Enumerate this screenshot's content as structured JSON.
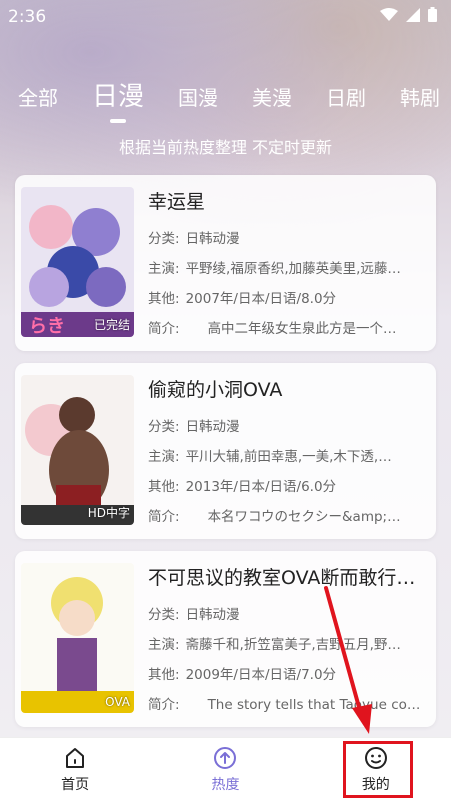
{
  "status_bar": {
    "time": "2:36"
  },
  "tabs": [
    {
      "label": "全部",
      "active": false
    },
    {
      "label": "日漫",
      "active": true
    },
    {
      "label": "国漫",
      "active": false
    },
    {
      "label": "美漫",
      "active": false
    },
    {
      "label": "日剧",
      "active": false
    },
    {
      "label": "韩剧",
      "active": false
    }
  ],
  "subtitle": "根据当前热度整理 不定时更新",
  "cards": [
    {
      "title": "幸运星",
      "category_key": "分类:",
      "category": "日韩动漫",
      "cast_key": "主演:",
      "cast": "平野绫,福原香织,加藤英美里,远藤…",
      "other_key": "其他:",
      "other": "2007年/日本/日语/8.0分",
      "intro_key": "简介:",
      "intro": "高中二年级女生泉此方是一个…",
      "badge": "已完结"
    },
    {
      "title": "偷窥的小洞OVA",
      "category_key": "分类:",
      "category": "日韩动漫",
      "cast_key": "主演:",
      "cast": "平川大辅,前田幸惠,一美,木下透,…",
      "other_key": "其他:",
      "other": "2013年/日本/日语/6.0分",
      "intro_key": "简介:",
      "intro": "本名ワコウのセクシー&amp;…",
      "badge": "HD中字"
    },
    {
      "title": "不可思议的教室OVA断而敢行…",
      "category_key": "分类:",
      "category": "日韩动漫",
      "cast_key": "主演:",
      "cast": "斋藤千和,折笠富美子,吉野五月,野…",
      "other_key": "其他:",
      "other": "2009年/日本/日语/7.0分",
      "intro_key": "简介:",
      "intro": "The story tells that Taoyue co…",
      "badge": "OVA"
    }
  ],
  "bottom_nav": [
    {
      "label": "首页",
      "icon": "home-icon",
      "active": false
    },
    {
      "label": "热度",
      "icon": "hot-upload-icon",
      "active": true
    },
    {
      "label": "我的",
      "icon": "smile-face-icon",
      "active": false
    }
  ],
  "colors": {
    "accent": "#7a6fd6",
    "highlight": "#e0141e"
  }
}
